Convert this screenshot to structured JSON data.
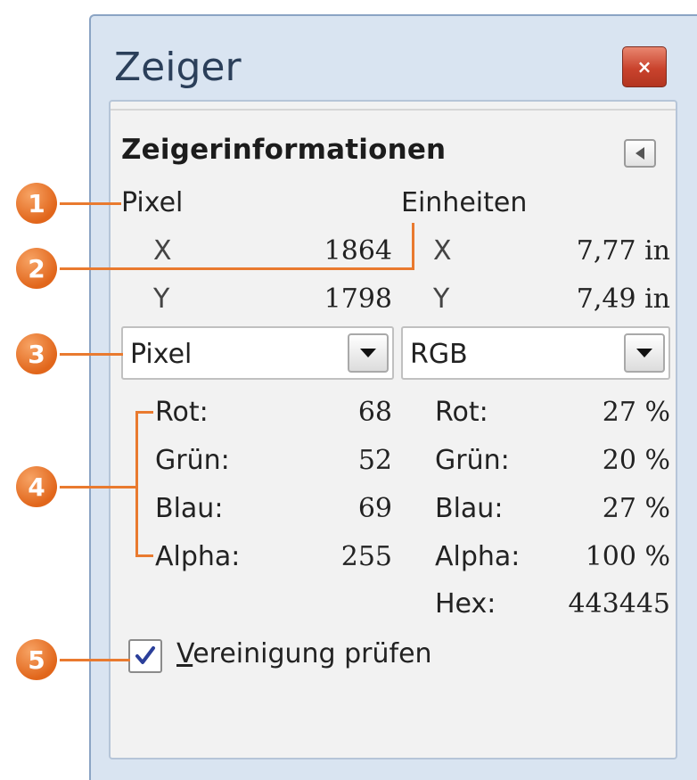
{
  "window": {
    "title": "Zeiger",
    "close_label": "×"
  },
  "panel": {
    "heading": "Zeigerinformationen"
  },
  "pixel": {
    "header": "Pixel",
    "x_label": "X",
    "x_value": "1864",
    "y_label": "Y",
    "y_value": "1798"
  },
  "units": {
    "header": "Einheiten",
    "x_label": "X",
    "x_value": "7,77 in",
    "y_label": "Y",
    "y_value": "7,49 in"
  },
  "selectors": {
    "left": "Pixel",
    "right": "RGB"
  },
  "color_left": [
    {
      "label": "Rot:",
      "value": "68"
    },
    {
      "label": "Grün:",
      "value": "52"
    },
    {
      "label": "Blau:",
      "value": "69"
    },
    {
      "label": "Alpha:",
      "value": "255"
    }
  ],
  "color_right": [
    {
      "label": "Rot:",
      "value": "27 %"
    },
    {
      "label": "Grün:",
      "value": "20 %"
    },
    {
      "label": "Blau:",
      "value": "27 %"
    },
    {
      "label": "Alpha:",
      "value": "100 %"
    },
    {
      "label": "Hex:",
      "value": "443445"
    }
  ],
  "sample_merged": {
    "label_first": "V",
    "label_rest": "ereinigung prüfen",
    "checked": true
  },
  "callouts": [
    "1",
    "2",
    "3",
    "4",
    "5"
  ],
  "colors": {
    "callout": "#e97a2f",
    "window_bg": "#d9e4f1",
    "close_button": "#c9432d"
  },
  "icons": {
    "close": "close-icon",
    "collapse": "triangle-left-icon",
    "dropdown": "triangle-down-icon",
    "check": "checkmark-icon"
  }
}
